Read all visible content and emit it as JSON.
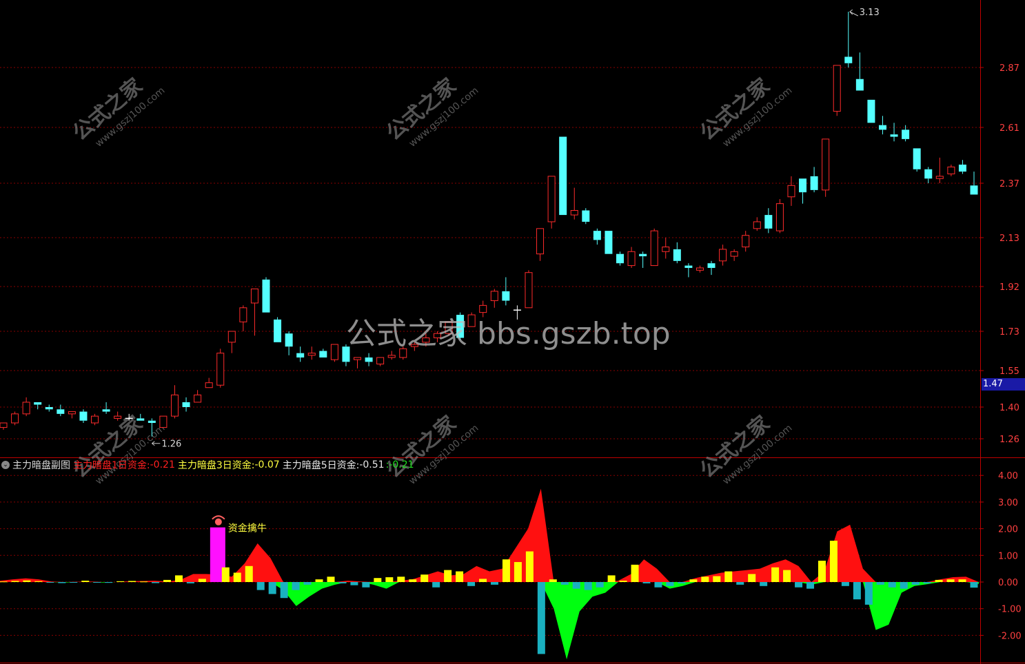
{
  "main_chart": {
    "price_axis_labels": [
      "2.87",
      "2.61",
      "2.37",
      "2.13",
      "1.92",
      "1.73",
      "1.55",
      "1.40",
      "1.26"
    ],
    "current_price": "1.47",
    "high_marker": "3.13",
    "low_marker": "1.26",
    "colors": {
      "up": "#ff2b2b",
      "down": "#54ffff",
      "doji": "#ffffff",
      "grid": "#8b0000",
      "axis_text": "#ff4040"
    }
  },
  "indicator": {
    "name": "主力暗盘副图",
    "line1_label": "主力暗盘1日资金:",
    "line1_value": "-0.21",
    "line2_label": "主力暗盘3日资金:",
    "line2_value": "-0.07",
    "line3_label": "主力暗盘5日资金:",
    "line3_value": "-0.51",
    "line4_value": ":-0.21",
    "signal_label": "资金擒牛",
    "axis_labels": [
      "4.00",
      "3.00",
      "2.00",
      "1.00",
      "0.00",
      "-1.00",
      "-2.00"
    ],
    "colors": {
      "pos_area": "#ff1010",
      "neg_area": "#00ff10",
      "pos_bar": "#ffff00",
      "neg_bar": "#1ab0c0",
      "signal_bar": "#ff10ff"
    }
  },
  "watermark": {
    "center_text": "公式之家 bbs.gszb.top",
    "logo_text": "公式之家",
    "logo_url": "www.gszj100.com"
  },
  "chart_data": [
    {
      "type": "candlestick",
      "title": "",
      "ylim": [
        1.2,
        3.18
      ],
      "yticks": [
        2.87,
        2.61,
        2.37,
        2.13,
        1.92,
        1.73,
        1.55,
        1.4,
        1.26
      ],
      "grid": true,
      "candles": [
        [
          1.31,
          1.33,
          1.3,
          1.33
        ],
        [
          1.33,
          1.38,
          1.32,
          1.37
        ],
        [
          1.37,
          1.44,
          1.36,
          1.42
        ],
        [
          1.42,
          1.42,
          1.39,
          1.41
        ],
        [
          1.4,
          1.41,
          1.38,
          1.39
        ],
        [
          1.39,
          1.41,
          1.36,
          1.37
        ],
        [
          1.37,
          1.38,
          1.35,
          1.38
        ],
        [
          1.38,
          1.39,
          1.33,
          1.34
        ],
        [
          1.33,
          1.37,
          1.32,
          1.36
        ],
        [
          1.39,
          1.42,
          1.37,
          1.38
        ],
        [
          1.35,
          1.38,
          1.34,
          1.36
        ],
        [
          1.35,
          1.37,
          1.34,
          1.35
        ],
        [
          1.35,
          1.37,
          1.34,
          1.34
        ],
        [
          1.34,
          1.35,
          1.27,
          1.33
        ],
        [
          1.31,
          1.36,
          1.31,
          1.36
        ],
        [
          1.36,
          1.49,
          1.35,
          1.45
        ],
        [
          1.42,
          1.44,
          1.38,
          1.4
        ],
        [
          1.42,
          1.47,
          1.42,
          1.45
        ],
        [
          1.48,
          1.52,
          1.48,
          1.5
        ],
        [
          1.49,
          1.65,
          1.48,
          1.63
        ],
        [
          1.68,
          1.73,
          1.63,
          1.73
        ],
        [
          1.77,
          1.84,
          1.73,
          1.83
        ],
        [
          1.85,
          1.91,
          1.71,
          1.91
        ],
        [
          1.95,
          1.96,
          1.81,
          1.81
        ],
        [
          1.78,
          1.79,
          1.68,
          1.68
        ],
        [
          1.72,
          1.73,
          1.62,
          1.66
        ],
        [
          1.63,
          1.66,
          1.59,
          1.61
        ],
        [
          1.62,
          1.66,
          1.6,
          1.63
        ],
        [
          1.64,
          1.65,
          1.61,
          1.61
        ],
        [
          1.6,
          1.67,
          1.59,
          1.67
        ],
        [
          1.66,
          1.67,
          1.57,
          1.59
        ],
        [
          1.6,
          1.61,
          1.56,
          1.61
        ],
        [
          1.61,
          1.63,
          1.57,
          1.59
        ],
        [
          1.58,
          1.61,
          1.57,
          1.61
        ],
        [
          1.61,
          1.64,
          1.6,
          1.62
        ],
        [
          1.61,
          1.66,
          1.6,
          1.65
        ],
        [
          1.66,
          1.68,
          1.64,
          1.67
        ],
        [
          1.68,
          1.72,
          1.66,
          1.7
        ],
        [
          1.7,
          1.73,
          1.68,
          1.72
        ],
        [
          1.72,
          1.77,
          1.71,
          1.77
        ],
        [
          1.8,
          1.81,
          1.69,
          1.7
        ],
        [
          1.75,
          1.81,
          1.75,
          1.8
        ],
        [
          1.81,
          1.86,
          1.79,
          1.84
        ],
        [
          1.86,
          1.91,
          1.83,
          1.9
        ],
        [
          1.9,
          1.96,
          1.84,
          1.86
        ],
        [
          1.82,
          1.84,
          1.78,
          1.82
        ],
        [
          1.83,
          1.99,
          1.83,
          1.98
        ],
        [
          2.06,
          2.17,
          2.03,
          2.17
        ],
        [
          2.2,
          2.32,
          2.17,
          2.4
        ],
        [
          2.57,
          2.57,
          2.23,
          2.23
        ],
        [
          2.23,
          2.35,
          2.21,
          2.25
        ],
        [
          2.25,
          2.26,
          2.19,
          2.2
        ],
        [
          2.16,
          2.17,
          2.1,
          2.12
        ],
        [
          2.16,
          2.16,
          2.06,
          2.06
        ],
        [
          2.06,
          2.07,
          2.01,
          2.02
        ],
        [
          2.01,
          2.09,
          2.0,
          2.07
        ],
        [
          2.06,
          2.07,
          2.0,
          2.05
        ],
        [
          2.01,
          2.17,
          2.01,
          2.16
        ],
        [
          2.07,
          2.13,
          2.04,
          2.09
        ],
        [
          2.08,
          2.11,
          2.02,
          2.03
        ],
        [
          2.01,
          2.02,
          1.96,
          2.0
        ],
        [
          1.99,
          2.01,
          1.98,
          2.0
        ],
        [
          2.02,
          2.03,
          1.97,
          2.0
        ],
        [
          2.03,
          2.1,
          2.01,
          2.08
        ],
        [
          2.05,
          2.08,
          2.03,
          2.07
        ],
        [
          2.09,
          2.16,
          2.07,
          2.14
        ],
        [
          2.17,
          2.22,
          2.16,
          2.2
        ],
        [
          2.23,
          2.26,
          2.15,
          2.17
        ],
        [
          2.16,
          2.3,
          2.15,
          2.28
        ],
        [
          2.31,
          2.4,
          2.27,
          2.36
        ],
        [
          2.39,
          2.39,
          2.28,
          2.33
        ],
        [
          2.4,
          2.44,
          2.33,
          2.34
        ],
        [
          2.34,
          2.43,
          2.31,
          2.56
        ],
        [
          2.68,
          2.78,
          2.66,
          2.88
        ],
        [
          2.92,
          3.13,
          2.87,
          2.89
        ],
        [
          2.82,
          2.94,
          2.77,
          2.77
        ],
        [
          2.73,
          2.73,
          2.63,
          2.63
        ],
        [
          2.62,
          2.66,
          2.58,
          2.6
        ],
        [
          2.58,
          2.63,
          2.55,
          2.57
        ],
        [
          2.6,
          2.62,
          2.55,
          2.56
        ],
        [
          2.52,
          2.52,
          2.42,
          2.43
        ],
        [
          2.43,
          2.44,
          2.37,
          2.39
        ],
        [
          2.39,
          2.48,
          2.37,
          2.4
        ],
        [
          2.41,
          2.45,
          2.4,
          2.44
        ],
        [
          2.45,
          2.47,
          2.41,
          2.42
        ],
        [
          2.36,
          2.42,
          2.32,
          2.32
        ]
      ],
      "colors": {
        "up": "#ff2b2b",
        "down": "#54ffff"
      }
    },
    {
      "type": "bar",
      "title": "",
      "ylim": [
        -2.6,
        4.4
      ],
      "yticks": [
        4.0,
        3.0,
        2.0,
        1.0,
        0.0,
        -1.0,
        -2.0
      ],
      "grid": true,
      "series": [
        {
          "name": "主力暗盘1日资金",
          "values": [
            0.02,
            0.04,
            0.06,
            0.03,
            -0.02,
            -0.04,
            -0.02,
            0.05,
            -0.02,
            -0.03,
            0.03,
            0.04,
            0.02,
            -0.04,
            0.08,
            0.25,
            -0.05,
            0.12,
            2.05,
            0.55,
            0.35,
            0.6,
            -0.3,
            -0.45,
            -0.6,
            -0.3,
            -0.1,
            0.1,
            0.2,
            -0.05,
            -0.12,
            -0.2,
            0.15,
            0.18,
            0.2,
            0.1,
            0.28,
            -0.2,
            0.45,
            0.4,
            -0.15,
            0.12,
            -0.1,
            0.85,
            0.75,
            1.15,
            -2.7,
            0.1,
            -0.1,
            -0.25,
            -0.3,
            -0.2,
            0.25,
            0.05,
            0.65,
            -0.05,
            -0.2,
            -0.15,
            -0.05,
            0.1,
            0.2,
            0.22,
            0.4,
            -0.1,
            0.3,
            -0.15,
            0.55,
            0.45,
            -0.2,
            -0.25,
            0.8,
            1.55,
            -0.15,
            -0.65,
            -0.85,
            -0.1,
            -0.2,
            -0.25,
            -0.1,
            -0.05,
            0.08,
            0.1,
            0.1,
            -0.21
          ]
        },
        {
          "name": "主力暗盘3日资金",
          "values": [
            0.05,
            0.1,
            0.14,
            0.1,
            0.02,
            -0.02,
            0.01,
            0.02,
            -0.02,
            0.0,
            0.03,
            0.04,
            0.05,
            0.02,
            0.08,
            0.3,
            0.3,
            0.28,
            0.2,
            0.7,
            1.45,
            0.9,
            -0.3,
            -0.9,
            -0.55,
            -0.25,
            -0.1,
            0.05,
            0.02,
            -0.1,
            -0.25,
            0.05,
            0.1,
            0.25,
            0.4,
            0.25,
            0.3,
            0.6,
            0.4,
            0.5,
            1.25,
            2.0,
            3.5,
            -1.0,
            -2.9,
            -1.1,
            -0.55,
            -0.4,
            0.05,
            0.3,
            0.85,
            0.5,
            -0.25,
            -0.15,
            0.15,
            0.25,
            0.35,
            0.4,
            0.45,
            0.5,
            0.7,
            0.85,
            0.6,
            -0.1,
            0.4,
            1.9,
            2.15,
            0.5,
            -1.8,
            -1.6,
            -0.4,
            -0.15,
            -0.08,
            0.1,
            0.18,
            0.2,
            -0.07
          ]
        }
      ],
      "signal": {
        "label": "资金擒牛",
        "index": 18,
        "value": 2.05
      },
      "colors": {
        "pos_area": "#ff1010",
        "neg_area": "#00ff10",
        "pos_bar": "#ffff00",
        "neg_bar": "#1ab0c0",
        "signal_bar": "#ff10ff"
      }
    }
  ]
}
